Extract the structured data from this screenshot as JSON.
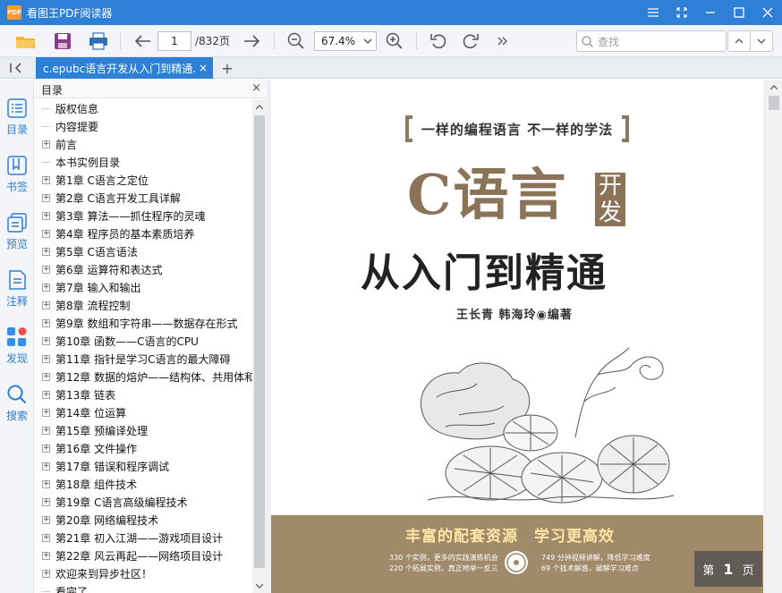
{
  "app": {
    "logo": "PDF",
    "title": "看图王PDF阅读器"
  },
  "toolbar": {
    "current_page": "1",
    "total_pages": "/832页",
    "zoom": "67.4%",
    "search_placeholder": "查找"
  },
  "tab": {
    "label": "c.epubc语言开发从入门到精通.",
    "close": "×",
    "new_tab": "+"
  },
  "sidebar": {
    "items": [
      {
        "label": "目录",
        "icon": "list-icon"
      },
      {
        "label": "书签",
        "icon": "bookmark-icon"
      },
      {
        "label": "预览",
        "icon": "thumbnail-icon"
      },
      {
        "label": "注释",
        "icon": "annotation-icon"
      },
      {
        "label": "发现",
        "icon": "discover-icon"
      },
      {
        "label": "搜索",
        "icon": "search-icon"
      }
    ]
  },
  "toc": {
    "title": "目录",
    "close": "×",
    "items": [
      {
        "text": "版权信息",
        "expandable": false
      },
      {
        "text": "内容提要",
        "expandable": false
      },
      {
        "text": "前言",
        "expandable": true
      },
      {
        "text": "本书实例目录",
        "expandable": false
      },
      {
        "text": "第1章 C语言之定位",
        "expandable": true
      },
      {
        "text": "第2章 C语言开发工具详解",
        "expandable": true
      },
      {
        "text": "第3章 算法——抓住程序的灵魂",
        "expandable": true
      },
      {
        "text": "第4章 程序员的基本素质培养",
        "expandable": true
      },
      {
        "text": "第5章 C语言语法",
        "expandable": true
      },
      {
        "text": "第6章 运算符和表达式",
        "expandable": true
      },
      {
        "text": "第7章 输入和输出",
        "expandable": true
      },
      {
        "text": "第8章 流程控制",
        "expandable": true
      },
      {
        "text": "第9章 数组和字符串——数据存在形式",
        "expandable": true
      },
      {
        "text": "第10章 函数——C语言的CPU",
        "expandable": true
      },
      {
        "text": "第11章 指针是学习C语言的最大障碍",
        "expandable": true
      },
      {
        "text": "第12章 数据的熔炉——结构体、共用体和",
        "expandable": true
      },
      {
        "text": "第13章 链表",
        "expandable": true
      },
      {
        "text": "第14章 位运算",
        "expandable": true
      },
      {
        "text": "第15章 预编译处理",
        "expandable": true
      },
      {
        "text": "第16章 文件操作",
        "expandable": true
      },
      {
        "text": "第17章 错误和程序调试",
        "expandable": true
      },
      {
        "text": "第18章 组件技术",
        "expandable": true
      },
      {
        "text": "第19章 C语言高级编程技术",
        "expandable": true
      },
      {
        "text": "第20章 网络编程技术",
        "expandable": true
      },
      {
        "text": "第21章 初入江湖——游戏项目设计",
        "expandable": true
      },
      {
        "text": "第22章 风云再起——网络项目设计",
        "expandable": true
      },
      {
        "text": "欢迎来到异步社区！",
        "expandable": true
      },
      {
        "text": "看完了",
        "expandable": false
      }
    ]
  },
  "cover": {
    "slogan": "一样的编程语言 不一样的学法",
    "title_c": "C语言",
    "title_badge": "开发",
    "title_main": "从入门到精通",
    "authors": "王长青 韩海玲◉编著",
    "band_title": "丰富的配套资源　学习更高效",
    "band_l1": "330 个实例，更多的实践演练机会",
    "band_l2": "220 个拓展实例，真正地举一反三",
    "band_r1": "749 分钟视频讲解，降低学习难度",
    "band_r2": "69 个技术解惑，破解学习难点"
  },
  "page_indicator": {
    "prefix": "第",
    "num": "1",
    "suffix": "页"
  },
  "colors": {
    "accent": "#2e7fd6",
    "cover_brown": "#8b7358",
    "band": "#a08a6a"
  }
}
